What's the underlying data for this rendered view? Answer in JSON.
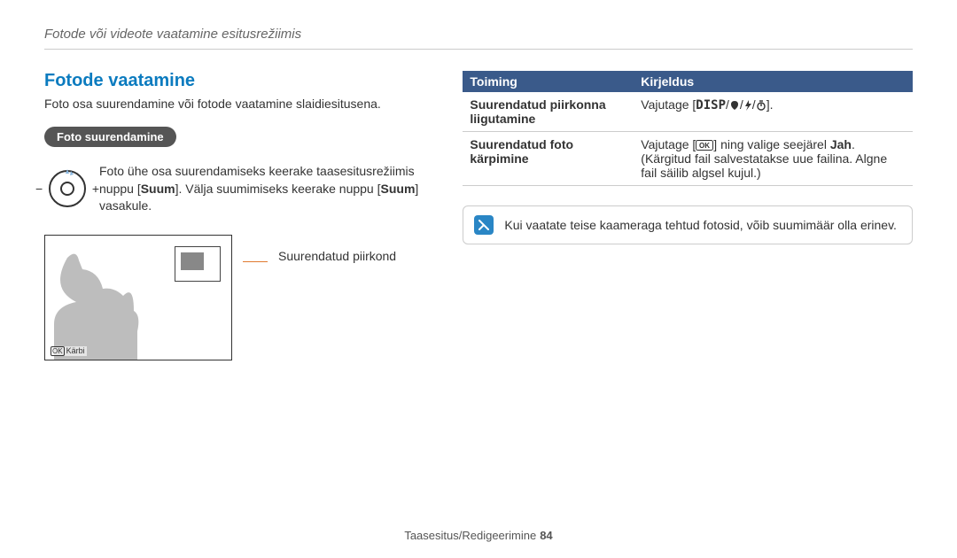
{
  "breadcrumb": "Fotode või videote vaatamine esitusrežiimis",
  "title": "Fotode vaatamine",
  "intro": "Foto osa suurendamine või fotode vaatamine slaidiesitusena.",
  "pill": "Foto suurendamine",
  "zoom_text_pre": "Foto ühe osa suurendamiseks keerake taasesitusrežiimis nuppu [",
  "zoom_text_bold1": "Suum",
  "zoom_text_mid": "]. Välja suumimiseks keerake nuppu [",
  "zoom_text_bold2": "Suum",
  "zoom_text_post": "] vasakule.",
  "crop_label": "Kärbi",
  "pointer_label": "Suurendatud piirkond",
  "table": {
    "head_action": "Toiming",
    "head_desc": "Kirjeldus",
    "rows": [
      {
        "action": "Suurendatud piirkonna liigutamine",
        "desc_pre": "Vajutage [",
        "desc_key": "DISP",
        "desc_post": "].",
        "icons": "pan"
      },
      {
        "action": "Suurendatud foto kärpimine",
        "desc_pre": "Vajutage [",
        "desc_key": "OK",
        "desc_mid": "] ning valige seejärel ",
        "desc_bold": "Jah",
        "desc_post": ". (Kärgitud fail salvestatakse uue failina. Algne fail säilib algsel kujul.)",
        "icons": "ok"
      }
    ]
  },
  "note": "Kui vaatate teise kaameraga tehtud fotosid, võib suumimäär olla erinev.",
  "footer_section": "Taasesitus/Redigeerimine",
  "footer_page": "84"
}
